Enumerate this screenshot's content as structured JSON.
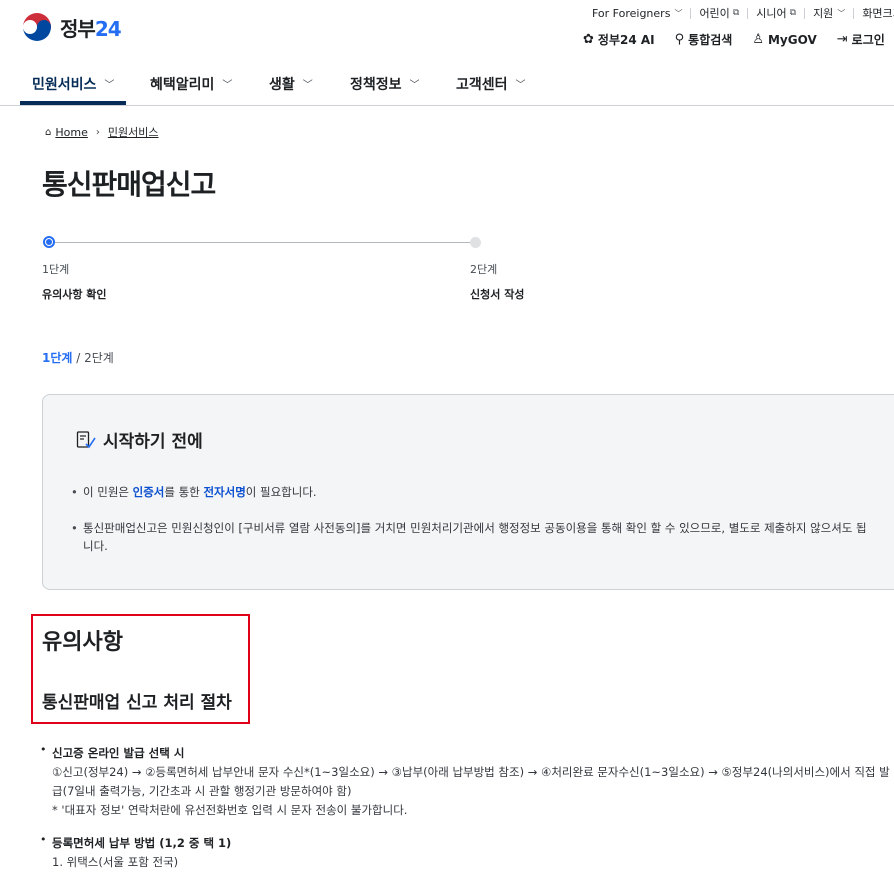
{
  "header": {
    "brand": "정부",
    "brand_num": "24",
    "utility": [
      {
        "label": "For Foreigners",
        "mark": "chevron"
      },
      {
        "label": "어린이",
        "mark": "external"
      },
      {
        "label": "시니어",
        "mark": "external"
      },
      {
        "label": "지원",
        "mark": "chevron"
      },
      {
        "label": "화면크기",
        "mark": ""
      }
    ],
    "quick": [
      {
        "icon": "ai-icon",
        "label": "정부24 AI"
      },
      {
        "icon": "search-icon",
        "label": "통합검색"
      },
      {
        "icon": "user-icon",
        "label": "MyGOV"
      },
      {
        "icon": "login-icon",
        "label": "로그인"
      }
    ]
  },
  "gnb": [
    {
      "label": "민원서비스",
      "active": true
    },
    {
      "label": "혜택알리미",
      "active": false
    },
    {
      "label": "생활",
      "active": false
    },
    {
      "label": "정책정보",
      "active": false
    },
    {
      "label": "고객센터",
      "active": false
    }
  ],
  "breadcrumb": {
    "home": "Home",
    "current": "민원서비스"
  },
  "page_title": "통신판매업신고",
  "steps": [
    {
      "num": "1단계",
      "name": "유의사항 확인",
      "current": true
    },
    {
      "num": "2단계",
      "name": "신청서 작성",
      "current": false
    }
  ],
  "step_indicator": {
    "current": "1단계",
    "rest": " / 2단계"
  },
  "notice": {
    "title": "시작하기 전에",
    "item1": {
      "pre": "이 민원은 ",
      "hl1": "인증서",
      "mid": "를 통한 ",
      "hl2": "전자서명",
      "post": "이 필요합니다."
    },
    "item2": "통신판매업신고은 민원신청인이 [구비서류 열람 사전동의]를 거치면 민원처리기관에서 행정정보 공동이용을 통해 확인 할 수 있으므로, 별도로 제출하지 않으셔도 됩니다."
  },
  "caution": {
    "title": "유의사항",
    "subtitle": "통신판매업 신고 처리 절차",
    "blocks": [
      {
        "head": "신고증 온라인 발급 선택 시",
        "lines": [
          "①신고(정부24) → ②등록면허세 납부안내 문자 수신*(1~3일소요) → ③납부(아래 납부방법 참조) → ④처리완료 문자수신(1~3일소요) → ⑤정부24(나의서비스)에서 직접 발급(7일내 출력가능, 기간초과 시 관할 행정기관 방문하여야 함)",
          "* '대표자 정보' 연락처란에 유선전화번호 입력 시 문자 전송이 불가합니다."
        ]
      },
      {
        "head": "등록면허세 납부 방법 (1,2 중 택 1)",
        "lines": [
          "1. 위택스(서울 포함 전국)"
        ]
      }
    ]
  },
  "colors": {
    "primary": "#256ef4",
    "navy": "#052b57",
    "highlight_border": "#e0001a",
    "box_bg": "#f4f5f6"
  }
}
